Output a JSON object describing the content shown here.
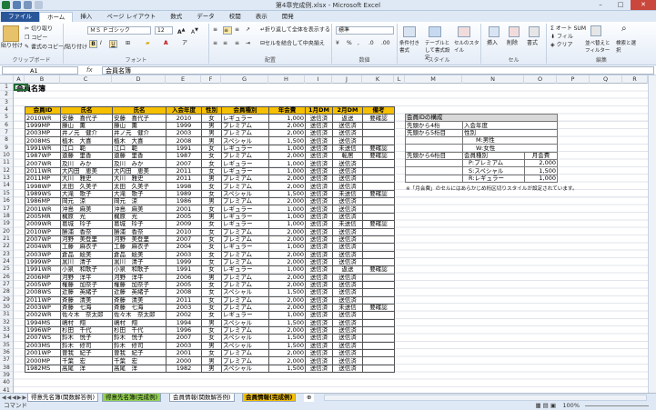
{
  "window": {
    "title": "第4章完成例.xlsx - Microsoft Excel"
  },
  "ribbon_tabs": [
    "ファイル",
    "ホーム",
    "挿入",
    "ページ レイアウト",
    "数式",
    "データ",
    "校閲",
    "表示",
    "開発"
  ],
  "ribbon": {
    "paste": "貼り付け",
    "cut": "切り取り",
    "copy": "コピー",
    "format_painter": "書式のコピー/貼り付け",
    "clipboard": "クリップボード",
    "font_name": "ＭＳ Ｐゴシック",
    "font_size": "12",
    "font": "フォント",
    "wrap_text": "折り返して全体を表示する",
    "merge_center": "セルを結合して中央揃え",
    "alignment": "配置",
    "number_format": "標準",
    "number": "数値",
    "cond_format": "条件付き書式",
    "table_format": "テーブルとして書式設定",
    "cell_style": "セルのスタイル",
    "styles": "スタイル",
    "insert": "挿入",
    "delete": "削除",
    "format": "書式",
    "cells": "セル",
    "autosum": "オート SUM",
    "fill": "フィル",
    "clear": "クリア",
    "sort_filter": "並べ替えとフィルター",
    "find_select": "検索と選択",
    "editing": "編集"
  },
  "formula_bar": {
    "name_box": "A1",
    "fx": "fx",
    "content": "会員名簿"
  },
  "columns": [
    "A",
    "B",
    "C",
    "D",
    "E",
    "F",
    "G",
    "H",
    "I",
    "J",
    "K",
    "L",
    "M",
    "N",
    "O",
    "P",
    "Q",
    "R"
  ],
  "sheet": {
    "title": "会員名簿",
    "headers": [
      "会員ID",
      "氏名",
      "氏名",
      "入会年度",
      "性別",
      "会員種別",
      "年会費",
      "1月DM",
      "2月DM",
      "備考"
    ],
    "rows": [
      [
        "2010WR",
        "安藤　喜代子",
        "安藤　喜代子",
        "2010",
        "女",
        "レギュラー",
        "1,000",
        "送信済",
        "返送",
        "要確認"
      ],
      [
        "1999MP",
        "藤山　薫",
        "藤山　薫",
        "1999",
        "男",
        "プレミアム",
        "2,000",
        "送信済",
        "送信済",
        ""
      ],
      [
        "2003MP",
        "井ノ元　健介",
        "井ノ元　健介",
        "2003",
        "男",
        "プレミアム",
        "2,000",
        "送信済",
        "送信済",
        ""
      ],
      [
        "2008MS",
        "植木　大喜",
        "植木　大喜",
        "2008",
        "男",
        "スペシャル",
        "1,500",
        "送信済",
        "送信済",
        ""
      ],
      [
        "1991WR",
        "江口　範",
        "江口　範",
        "1991",
        "女",
        "レギュラー",
        "1,000",
        "送信済",
        "未送信",
        "要確認"
      ],
      [
        "1987WP",
        "遠藤　里香",
        "遠藤　里香",
        "1987",
        "女",
        "プレミアム",
        "2,000",
        "送信済",
        "転居",
        "要確認"
      ],
      [
        "2007WR",
        "及川　みか",
        "及川　みか",
        "2007",
        "女",
        "レギュラー",
        "1,000",
        "送信済",
        "送信済",
        ""
      ],
      [
        "2011WR",
        "大内田　恵美",
        "大内田　恵美",
        "2011",
        "女",
        "レギュラー",
        "1,000",
        "送信済",
        "送信済",
        ""
      ],
      [
        "2011MP",
        "大川　雅史",
        "大川　雅史",
        "2011",
        "男",
        "プレミアム",
        "2,000",
        "送信済",
        "送信済",
        ""
      ],
      [
        "1998WP",
        "太田　久美子",
        "太田　久美子",
        "1998",
        "女",
        "プレミアム",
        "2,000",
        "送信済",
        "送信済",
        ""
      ],
      [
        "1989WS",
        "大滝　歌子",
        "大滝　歌子",
        "1989",
        "女",
        "スペシャル",
        "1,500",
        "送信済",
        "未送信",
        "要確認"
      ],
      [
        "1986MP",
        "岡元　涼",
        "岡元　涼",
        "1986",
        "男",
        "プレミアム",
        "2,000",
        "送信済",
        "送信済",
        ""
      ],
      [
        "2001WR",
        "沖島　麻美",
        "沖島　麻美",
        "2001",
        "女",
        "レギュラー",
        "1,000",
        "送信済",
        "送信済",
        ""
      ],
      [
        "2005MR",
        "梶原　光",
        "梶原　光",
        "2005",
        "男",
        "レギュラー",
        "1,000",
        "送信済",
        "送信済",
        ""
      ],
      [
        "2009WR",
        "葛城　玲子",
        "葛城　玲子",
        "2009",
        "女",
        "レギュラー",
        "1,000",
        "送信済",
        "未送信",
        "要確認"
      ],
      [
        "2010WP",
        "勝浦　香奈",
        "勝浦　香奈",
        "2010",
        "女",
        "プレミアム",
        "2,000",
        "送信済",
        "送信済",
        ""
      ],
      [
        "2007WP",
        "河野　美登里",
        "河野　美登里",
        "2007",
        "女",
        "プレミアム",
        "2,000",
        "送信済",
        "送信済",
        ""
      ],
      [
        "2004WR",
        "工藤　麻衣子",
        "工藤　麻衣子",
        "2004",
        "女",
        "レギュラー",
        "1,000",
        "送信済",
        "送信済",
        ""
      ],
      [
        "2003WP",
        "倉品　絵美",
        "倉品　絵美",
        "2003",
        "女",
        "プレミアム",
        "2,000",
        "送信済",
        "送信済",
        ""
      ],
      [
        "1999WP",
        "黒川　清子",
        "黒川　清子",
        "1999",
        "女",
        "プレミアム",
        "2,000",
        "送信済",
        "送信済",
        ""
      ],
      [
        "1991WR",
        "小泉　和歌子",
        "小泉　和歌子",
        "1991",
        "女",
        "レギュラー",
        "1,000",
        "送信済",
        "返送",
        "要確認"
      ],
      [
        "2006MP",
        "河野　洋平",
        "河野　洋平",
        "2006",
        "男",
        "プレミアム",
        "2,000",
        "送信済",
        "送信済",
        ""
      ],
      [
        "2005WP",
        "権藤　加奈子",
        "権藤　加奈子",
        "2005",
        "女",
        "プレミアム",
        "2,000",
        "送信済",
        "送信済",
        ""
      ],
      [
        "2008WS",
        "近藤　英緒子",
        "近藤　英緒子",
        "2008",
        "女",
        "スペシャル",
        "1,500",
        "送信済",
        "送信済",
        ""
      ],
      [
        "2011WP",
        "斉藤　清美",
        "斉藤　清美",
        "2011",
        "女",
        "プレミアム",
        "2,000",
        "送信済",
        "送信済",
        ""
      ],
      [
        "2003WP",
        "斉藤　七海",
        "斉藤　七海",
        "2003",
        "女",
        "プレミアム",
        "2,000",
        "送信済",
        "未送信",
        "要確認"
      ],
      [
        "2002WR",
        "佐々木　奈太郎",
        "佐々木　奈太郎",
        "2002",
        "女",
        "レギュラー",
        "1,000",
        "送信済",
        "送信済",
        ""
      ],
      [
        "1994MS",
        "嶋村　翔",
        "嶋村　翔",
        "1994",
        "男",
        "スペシャル",
        "1,500",
        "送信済",
        "送信済",
        ""
      ],
      [
        "1996WP",
        "杉田　千代",
        "杉田　千代",
        "1996",
        "女",
        "プレミアム",
        "2,000",
        "送信済",
        "送信済",
        ""
      ],
      [
        "2007WS",
        "鈴木　悦子",
        "鈴木　悦子",
        "2007",
        "女",
        "スペシャル",
        "1,500",
        "送信済",
        "送信済",
        ""
      ],
      [
        "2003MS",
        "鈴木　修司",
        "鈴木　修司",
        "2003",
        "男",
        "スペシャル",
        "1,500",
        "送信済",
        "送信済",
        ""
      ],
      [
        "2001WP",
        "曽我　紀子",
        "曽我　紀子",
        "2001",
        "女",
        "プレミアム",
        "2,000",
        "送信済",
        "送信済",
        ""
      ],
      [
        "2000MP",
        "千葉　宏",
        "千葉　宏",
        "2000",
        "男",
        "プレミアム",
        "2,000",
        "送信済",
        "送信済",
        ""
      ],
      [
        "1982MS",
        "高尾　洋",
        "高尾　洋",
        "1982",
        "男",
        "スペシャル",
        "1,500",
        "送信済",
        "送信済",
        ""
      ]
    ]
  },
  "side_table": {
    "title": "会員IDの構成",
    "rows": [
      [
        "先頭から4桁",
        "入会年度",
        ""
      ],
      [
        "先頭から5桁目",
        "性別",
        ""
      ],
      [
        "",
        "M:男性",
        ""
      ],
      [
        "",
        "W:女性",
        ""
      ],
      [
        "先頭から6桁目",
        "会員種別",
        "月会費"
      ],
      [
        "",
        "P:プレミアム",
        "2,000"
      ],
      [
        "",
        "S:スペシャル",
        "1,500"
      ],
      [
        "",
        "R:レギュラー",
        "1,000"
      ]
    ],
    "note": "※「月会費」のセルにはあらかじめ桁区切りスタイルが設定されています。"
  },
  "sheet_tabs": [
    "得意先名簿(関数解答例)",
    "得意先名簿(完成例)",
    "会員情報(関数解答例)",
    "会員情報(完成例)"
  ],
  "status": {
    "left": "コマンド",
    "zoom": "100%"
  }
}
